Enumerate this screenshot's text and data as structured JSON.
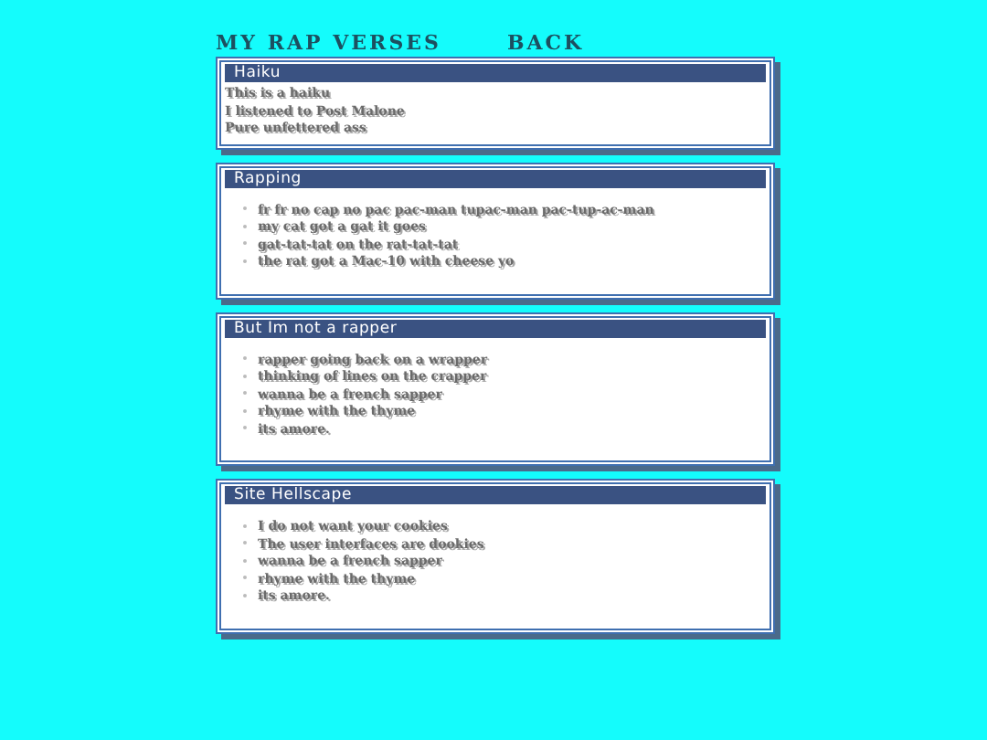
{
  "header": {
    "title": "MY RAP VERSES",
    "back_link": "BACK"
  },
  "sections": [
    {
      "title": "Haiku",
      "kind": "plain",
      "lines": [
        "This is a haiku",
        "I listened to Post Malone",
        "Pure unfettered ass"
      ]
    },
    {
      "title": "Rapping",
      "kind": "bulleted",
      "lines": [
        "fr fr no cap no pac pac-man tupac-man pac-tup-ac-man",
        "my cat got a gat it goes",
        "gat-tat-tat on the rat-tat-tat",
        "the rat got a Mac-10 with cheese yo"
      ]
    },
    {
      "title": "But Im not a rapper",
      "kind": "bulleted",
      "lines": [
        "rapper going back on a wrapper",
        "thinking of lines on the crapper",
        "wanna be a french sapper",
        "rhyme with the thyme",
        "its amore."
      ]
    },
    {
      "title": "Site Hellscape",
      "kind": "bulleted",
      "lines": [
        "I do not want your cookies",
        "The user interfaces are dookies",
        "wanna be a french sapper",
        "rhyme with the thyme",
        "its amore."
      ]
    }
  ]
}
